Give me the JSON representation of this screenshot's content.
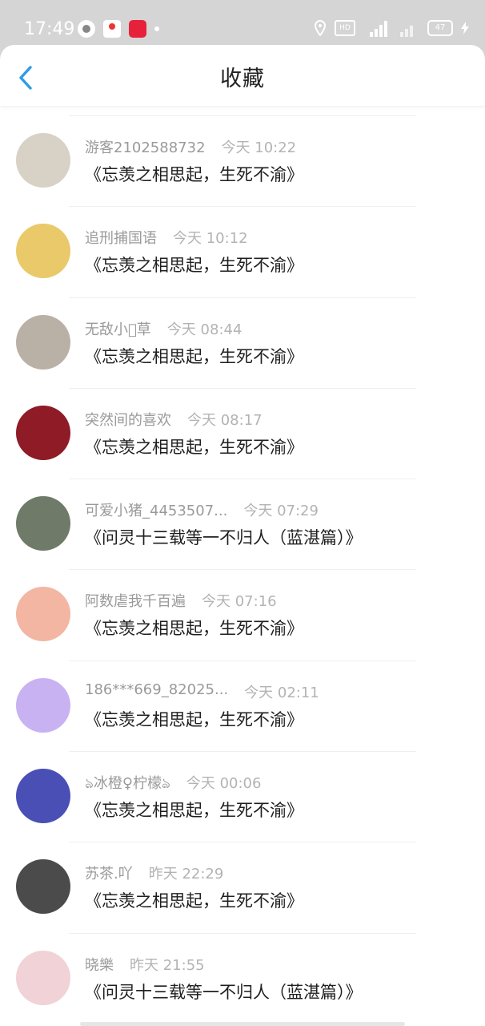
{
  "status_bar": {
    "time": "17:49",
    "hd_label": "HD",
    "battery": "47"
  },
  "header": {
    "title": "收藏"
  },
  "items": [
    {
      "username": "游客2102588732",
      "time": "今天 10:22",
      "title": "《忘羡之相思起，生死不渝》",
      "avatar_color": "#d8d1c6"
    },
    {
      "username": "追刑捕国语",
      "time": "今天 10:12",
      "title": "《忘羡之相思起，生死不渝》",
      "avatar_color": "#e9c96a"
    },
    {
      "username": "无敌小\u0000草",
      "time": "今天 08:44",
      "title": "《忘羡之相思起，生死不渝》",
      "avatar_color": "#b9b0a6"
    },
    {
      "username": "突然间的喜欢",
      "time": "今天 08:17",
      "title": "《忘羡之相思起，生死不渝》",
      "avatar_color": "#8e1b25"
    },
    {
      "username": "可爱小猪_4453507...",
      "time": "今天 07:29",
      "title": "《问灵十三载等一不归人（蓝湛篇）》",
      "avatar_color": "#6f7a68"
    },
    {
      "username": "阿数虐我千百遍",
      "time": "今天 07:16",
      "title": "《忘羡之相思起，生死不渝》",
      "avatar_color": "#f2b6a2"
    },
    {
      "username": "186***669_82025...",
      "time": "今天 02:11",
      "title": "《忘羡之相思起，生死不渝》",
      "avatar_color": "#c8b2f2"
    },
    {
      "username": "ঌ冰橙♀柠檬ঌ",
      "time": "今天 00:06",
      "title": "《忘羡之相思起，生死不渝》",
      "avatar_color": "#4a4fb5"
    },
    {
      "username": "苏茶.吖",
      "time": "昨天 22:29",
      "title": "《忘羡之相思起，生死不渝》",
      "avatar_color": "#4b4b4b"
    },
    {
      "username": "晓樂",
      "time": "昨天 21:55",
      "title": "《问灵十三载等一不归人（蓝湛篇）》",
      "avatar_color": "#f1d2d6"
    }
  ]
}
